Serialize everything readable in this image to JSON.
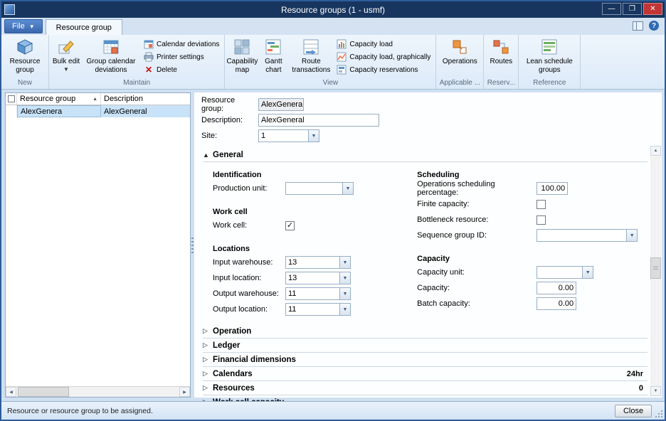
{
  "window": {
    "title": "Resource groups (1 - usmf)",
    "statusbar": {
      "text": "Resource or resource group to be assigned.",
      "close_label": "Close"
    }
  },
  "ribbon": {
    "file_label": "File",
    "active_tab": "Resource group",
    "groups": {
      "new": {
        "label": "New",
        "resource_group": "Resource group"
      },
      "maintain": {
        "label": "Maintain",
        "bulk_edit": "Bulk edit",
        "group_calendar_deviations": "Group calendar deviations",
        "calendar_deviations": "Calendar deviations",
        "printer_settings": "Printer settings",
        "delete": "Delete"
      },
      "view": {
        "label": "View",
        "capability_map": "Capability map",
        "gantt_chart": "Gantt chart",
        "route_transactions": "Route transactions",
        "capacity_load": "Capacity load",
        "capacity_load_graphically": "Capacity load, graphically",
        "capacity_reservations": "Capacity reservations"
      },
      "applicable": {
        "label": "Applicable ...",
        "operations": "Operations"
      },
      "reservations": {
        "label": "Reserv...",
        "routes": "Routes"
      },
      "reference": {
        "label": "Reference",
        "lean_schedule_groups": "Lean schedule groups"
      }
    }
  },
  "grid": {
    "columns": {
      "resource_group": "Resource group",
      "description": "Description"
    },
    "rows": [
      {
        "resource_group": "AlexGenera",
        "description": "AlexGeneral"
      }
    ]
  },
  "form": {
    "resource_group": {
      "label": "Resource group:",
      "value": "AlexGenera"
    },
    "description": {
      "label": "Description:",
      "value": "AlexGeneral"
    },
    "site": {
      "label": "Site:",
      "value": "1"
    },
    "general": {
      "title": "General",
      "identification_header": "Identification",
      "production_unit": {
        "label": "Production unit:",
        "value": ""
      },
      "work_cell_header": "Work cell",
      "work_cell": {
        "label": "Work cell:",
        "checked": true
      },
      "locations_header": "Locations",
      "input_warehouse": {
        "label": "Input warehouse:",
        "value": "13"
      },
      "input_location": {
        "label": "Input location:",
        "value": "13"
      },
      "output_warehouse": {
        "label": "Output warehouse:",
        "value": "11"
      },
      "output_location": {
        "label": "Output location:",
        "value": "11"
      },
      "scheduling_header": "Scheduling",
      "operations_scheduling_percentage": {
        "label": "Operations scheduling percentage:",
        "value": "100.00"
      },
      "finite_capacity": {
        "label": "Finite capacity:",
        "checked": false
      },
      "bottleneck_resource": {
        "label": "Bottleneck resource:",
        "checked": false
      },
      "sequence_group_id": {
        "label": "Sequence group ID:",
        "value": ""
      },
      "capacity_header": "Capacity",
      "capacity_unit": {
        "label": "Capacity unit:",
        "value": ""
      },
      "capacity": {
        "label": "Capacity:",
        "value": "0.00"
      },
      "batch_capacity": {
        "label": "Batch capacity:",
        "value": "0.00"
      }
    },
    "sections": {
      "operation": {
        "title": "Operation"
      },
      "ledger": {
        "title": "Ledger"
      },
      "financial_dimensions": {
        "title": "Financial dimensions"
      },
      "calendars": {
        "title": "Calendars",
        "value": "24hr"
      },
      "resources": {
        "title": "Resources",
        "value": "0"
      },
      "work_cell_capacity": {
        "title": "Work cell capacity"
      }
    }
  }
}
